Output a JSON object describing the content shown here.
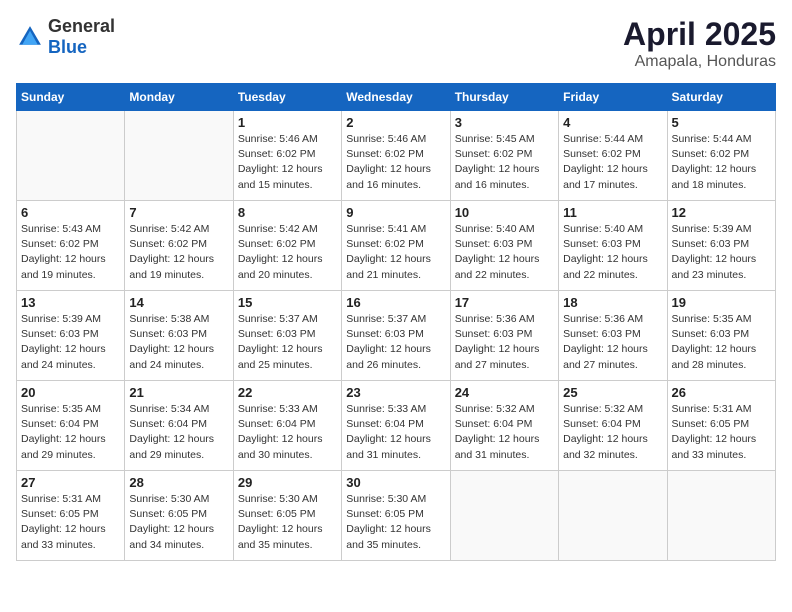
{
  "logo": {
    "general": "General",
    "blue": "Blue"
  },
  "title": {
    "month": "April 2025",
    "location": "Amapala, Honduras"
  },
  "weekdays": [
    "Sunday",
    "Monday",
    "Tuesday",
    "Wednesday",
    "Thursday",
    "Friday",
    "Saturday"
  ],
  "weeks": [
    [
      {
        "day": "",
        "sunrise": "",
        "sunset": "",
        "daylight": ""
      },
      {
        "day": "",
        "sunrise": "",
        "sunset": "",
        "daylight": ""
      },
      {
        "day": "1",
        "sunrise": "Sunrise: 5:46 AM",
        "sunset": "Sunset: 6:02 PM",
        "daylight": "Daylight: 12 hours and 15 minutes."
      },
      {
        "day": "2",
        "sunrise": "Sunrise: 5:46 AM",
        "sunset": "Sunset: 6:02 PM",
        "daylight": "Daylight: 12 hours and 16 minutes."
      },
      {
        "day": "3",
        "sunrise": "Sunrise: 5:45 AM",
        "sunset": "Sunset: 6:02 PM",
        "daylight": "Daylight: 12 hours and 16 minutes."
      },
      {
        "day": "4",
        "sunrise": "Sunrise: 5:44 AM",
        "sunset": "Sunset: 6:02 PM",
        "daylight": "Daylight: 12 hours and 17 minutes."
      },
      {
        "day": "5",
        "sunrise": "Sunrise: 5:44 AM",
        "sunset": "Sunset: 6:02 PM",
        "daylight": "Daylight: 12 hours and 18 minutes."
      }
    ],
    [
      {
        "day": "6",
        "sunrise": "Sunrise: 5:43 AM",
        "sunset": "Sunset: 6:02 PM",
        "daylight": "Daylight: 12 hours and 19 minutes."
      },
      {
        "day": "7",
        "sunrise": "Sunrise: 5:42 AM",
        "sunset": "Sunset: 6:02 PM",
        "daylight": "Daylight: 12 hours and 19 minutes."
      },
      {
        "day": "8",
        "sunrise": "Sunrise: 5:42 AM",
        "sunset": "Sunset: 6:02 PM",
        "daylight": "Daylight: 12 hours and 20 minutes."
      },
      {
        "day": "9",
        "sunrise": "Sunrise: 5:41 AM",
        "sunset": "Sunset: 6:02 PM",
        "daylight": "Daylight: 12 hours and 21 minutes."
      },
      {
        "day": "10",
        "sunrise": "Sunrise: 5:40 AM",
        "sunset": "Sunset: 6:03 PM",
        "daylight": "Daylight: 12 hours and 22 minutes."
      },
      {
        "day": "11",
        "sunrise": "Sunrise: 5:40 AM",
        "sunset": "Sunset: 6:03 PM",
        "daylight": "Daylight: 12 hours and 22 minutes."
      },
      {
        "day": "12",
        "sunrise": "Sunrise: 5:39 AM",
        "sunset": "Sunset: 6:03 PM",
        "daylight": "Daylight: 12 hours and 23 minutes."
      }
    ],
    [
      {
        "day": "13",
        "sunrise": "Sunrise: 5:39 AM",
        "sunset": "Sunset: 6:03 PM",
        "daylight": "Daylight: 12 hours and 24 minutes."
      },
      {
        "day": "14",
        "sunrise": "Sunrise: 5:38 AM",
        "sunset": "Sunset: 6:03 PM",
        "daylight": "Daylight: 12 hours and 24 minutes."
      },
      {
        "day": "15",
        "sunrise": "Sunrise: 5:37 AM",
        "sunset": "Sunset: 6:03 PM",
        "daylight": "Daylight: 12 hours and 25 minutes."
      },
      {
        "day": "16",
        "sunrise": "Sunrise: 5:37 AM",
        "sunset": "Sunset: 6:03 PM",
        "daylight": "Daylight: 12 hours and 26 minutes."
      },
      {
        "day": "17",
        "sunrise": "Sunrise: 5:36 AM",
        "sunset": "Sunset: 6:03 PM",
        "daylight": "Daylight: 12 hours and 27 minutes."
      },
      {
        "day": "18",
        "sunrise": "Sunrise: 5:36 AM",
        "sunset": "Sunset: 6:03 PM",
        "daylight": "Daylight: 12 hours and 27 minutes."
      },
      {
        "day": "19",
        "sunrise": "Sunrise: 5:35 AM",
        "sunset": "Sunset: 6:03 PM",
        "daylight": "Daylight: 12 hours and 28 minutes."
      }
    ],
    [
      {
        "day": "20",
        "sunrise": "Sunrise: 5:35 AM",
        "sunset": "Sunset: 6:04 PM",
        "daylight": "Daylight: 12 hours and 29 minutes."
      },
      {
        "day": "21",
        "sunrise": "Sunrise: 5:34 AM",
        "sunset": "Sunset: 6:04 PM",
        "daylight": "Daylight: 12 hours and 29 minutes."
      },
      {
        "day": "22",
        "sunrise": "Sunrise: 5:33 AM",
        "sunset": "Sunset: 6:04 PM",
        "daylight": "Daylight: 12 hours and 30 minutes."
      },
      {
        "day": "23",
        "sunrise": "Sunrise: 5:33 AM",
        "sunset": "Sunset: 6:04 PM",
        "daylight": "Daylight: 12 hours and 31 minutes."
      },
      {
        "day": "24",
        "sunrise": "Sunrise: 5:32 AM",
        "sunset": "Sunset: 6:04 PM",
        "daylight": "Daylight: 12 hours and 31 minutes."
      },
      {
        "day": "25",
        "sunrise": "Sunrise: 5:32 AM",
        "sunset": "Sunset: 6:04 PM",
        "daylight": "Daylight: 12 hours and 32 minutes."
      },
      {
        "day": "26",
        "sunrise": "Sunrise: 5:31 AM",
        "sunset": "Sunset: 6:05 PM",
        "daylight": "Daylight: 12 hours and 33 minutes."
      }
    ],
    [
      {
        "day": "27",
        "sunrise": "Sunrise: 5:31 AM",
        "sunset": "Sunset: 6:05 PM",
        "daylight": "Daylight: 12 hours and 33 minutes."
      },
      {
        "day": "28",
        "sunrise": "Sunrise: 5:30 AM",
        "sunset": "Sunset: 6:05 PM",
        "daylight": "Daylight: 12 hours and 34 minutes."
      },
      {
        "day": "29",
        "sunrise": "Sunrise: 5:30 AM",
        "sunset": "Sunset: 6:05 PM",
        "daylight": "Daylight: 12 hours and 35 minutes."
      },
      {
        "day": "30",
        "sunrise": "Sunrise: 5:30 AM",
        "sunset": "Sunset: 6:05 PM",
        "daylight": "Daylight: 12 hours and 35 minutes."
      },
      {
        "day": "",
        "sunrise": "",
        "sunset": "",
        "daylight": ""
      },
      {
        "day": "",
        "sunrise": "",
        "sunset": "",
        "daylight": ""
      },
      {
        "day": "",
        "sunrise": "",
        "sunset": "",
        "daylight": ""
      }
    ]
  ]
}
